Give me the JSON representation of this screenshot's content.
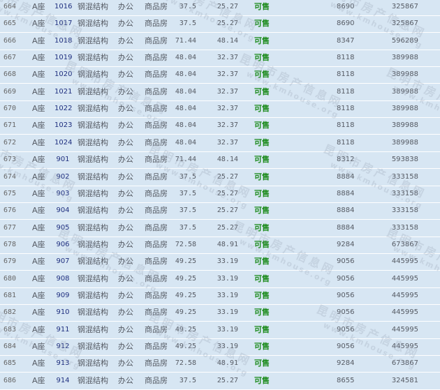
{
  "watermark": {
    "text": "昆明市房产信息网",
    "url": "www.kmhouse.org"
  },
  "rows": [
    {
      "idx": "664",
      "bldg": "A座",
      "room": "1016",
      "structure": "钢混结构",
      "use": "办公",
      "type": "商品房",
      "barea": "37.5",
      "iarea": "25.27",
      "status": "可售",
      "price": "8690",
      "total": "325867"
    },
    {
      "idx": "665",
      "bldg": "A座",
      "room": "1017",
      "structure": "钢混结构",
      "use": "办公",
      "type": "商品房",
      "barea": "37.5",
      "iarea": "25.27",
      "status": "可售",
      "price": "8690",
      "total": "325867"
    },
    {
      "idx": "666",
      "bldg": "A座",
      "room": "1018",
      "structure": "钢混结构",
      "use": "办公",
      "type": "商品房",
      "barea": "71.44",
      "iarea": "48.14",
      "status": "可售",
      "price": "8347",
      "total": "596289"
    },
    {
      "idx": "667",
      "bldg": "A座",
      "room": "1019",
      "structure": "钢混结构",
      "use": "办公",
      "type": "商品房",
      "barea": "48.04",
      "iarea": "32.37",
      "status": "可售",
      "price": "8118",
      "total": "389988"
    },
    {
      "idx": "668",
      "bldg": "A座",
      "room": "1020",
      "structure": "钢混结构",
      "use": "办公",
      "type": "商品房",
      "barea": "48.04",
      "iarea": "32.37",
      "status": "可售",
      "price": "8118",
      "total": "389988"
    },
    {
      "idx": "669",
      "bldg": "A座",
      "room": "1021",
      "structure": "钢混结构",
      "use": "办公",
      "type": "商品房",
      "barea": "48.04",
      "iarea": "32.37",
      "status": "可售",
      "price": "8118",
      "total": "389988"
    },
    {
      "idx": "670",
      "bldg": "A座",
      "room": "1022",
      "structure": "钢混结构",
      "use": "办公",
      "type": "商品房",
      "barea": "48.04",
      "iarea": "32.37",
      "status": "可售",
      "price": "8118",
      "total": "389988"
    },
    {
      "idx": "671",
      "bldg": "A座",
      "room": "1023",
      "structure": "钢混结构",
      "use": "办公",
      "type": "商品房",
      "barea": "48.04",
      "iarea": "32.37",
      "status": "可售",
      "price": "8118",
      "total": "389988"
    },
    {
      "idx": "672",
      "bldg": "A座",
      "room": "1024",
      "structure": "钢混结构",
      "use": "办公",
      "type": "商品房",
      "barea": "48.04",
      "iarea": "32.37",
      "status": "可售",
      "price": "8118",
      "total": "389988"
    },
    {
      "idx": "673",
      "bldg": "A座",
      "room": "901",
      "structure": "钢混结构",
      "use": "办公",
      "type": "商品房",
      "barea": "71.44",
      "iarea": "48.14",
      "status": "可售",
      "price": "8312",
      "total": "593838"
    },
    {
      "idx": "674",
      "bldg": "A座",
      "room": "902",
      "structure": "钢混结构",
      "use": "办公",
      "type": "商品房",
      "barea": "37.5",
      "iarea": "25.27",
      "status": "可售",
      "price": "8884",
      "total": "333158"
    },
    {
      "idx": "675",
      "bldg": "A座",
      "room": "903",
      "structure": "钢混结构",
      "use": "办公",
      "type": "商品房",
      "barea": "37.5",
      "iarea": "25.27",
      "status": "可售",
      "price": "8884",
      "total": "333158"
    },
    {
      "idx": "676",
      "bldg": "A座",
      "room": "904",
      "structure": "钢混结构",
      "use": "办公",
      "type": "商品房",
      "barea": "37.5",
      "iarea": "25.27",
      "status": "可售",
      "price": "8884",
      "total": "333158"
    },
    {
      "idx": "677",
      "bldg": "A座",
      "room": "905",
      "structure": "钢混结构",
      "use": "办公",
      "type": "商品房",
      "barea": "37.5",
      "iarea": "25.27",
      "status": "可售",
      "price": "8884",
      "total": "333158"
    },
    {
      "idx": "678",
      "bldg": "A座",
      "room": "906",
      "structure": "钢混结构",
      "use": "办公",
      "type": "商品房",
      "barea": "72.58",
      "iarea": "48.91",
      "status": "可售",
      "price": "9284",
      "total": "673867"
    },
    {
      "idx": "679",
      "bldg": "A座",
      "room": "907",
      "structure": "钢混结构",
      "use": "办公",
      "type": "商品房",
      "barea": "49.25",
      "iarea": "33.19",
      "status": "可售",
      "price": "9056",
      "total": "445995"
    },
    {
      "idx": "680",
      "bldg": "A座",
      "room": "908",
      "structure": "钢混结构",
      "use": "办公",
      "type": "商品房",
      "barea": "49.25",
      "iarea": "33.19",
      "status": "可售",
      "price": "9056",
      "total": "445995"
    },
    {
      "idx": "681",
      "bldg": "A座",
      "room": "909",
      "structure": "钢混结构",
      "use": "办公",
      "type": "商品房",
      "barea": "49.25",
      "iarea": "33.19",
      "status": "可售",
      "price": "9056",
      "total": "445995"
    },
    {
      "idx": "682",
      "bldg": "A座",
      "room": "910",
      "structure": "钢混结构",
      "use": "办公",
      "type": "商品房",
      "barea": "49.25",
      "iarea": "33.19",
      "status": "可售",
      "price": "9056",
      "total": "445995"
    },
    {
      "idx": "683",
      "bldg": "A座",
      "room": "911",
      "structure": "钢混结构",
      "use": "办公",
      "type": "商品房",
      "barea": "49.25",
      "iarea": "33.19",
      "status": "可售",
      "price": "9056",
      "total": "445995"
    },
    {
      "idx": "684",
      "bldg": "A座",
      "room": "912",
      "structure": "钢混结构",
      "use": "办公",
      "type": "商品房",
      "barea": "49.25",
      "iarea": "33.19",
      "status": "可售",
      "price": "9056",
      "total": "445995"
    },
    {
      "idx": "685",
      "bldg": "A座",
      "room": "913",
      "structure": "钢混结构",
      "use": "办公",
      "type": "商品房",
      "barea": "72.58",
      "iarea": "48.91",
      "status": "可售",
      "price": "9284",
      "total": "673867"
    },
    {
      "idx": "686",
      "bldg": "A座",
      "room": "914",
      "structure": "钢混结构",
      "use": "办公",
      "type": "商品房",
      "barea": "37.5",
      "iarea": "25.27",
      "status": "可售",
      "price": "8655",
      "total": "324581"
    }
  ]
}
